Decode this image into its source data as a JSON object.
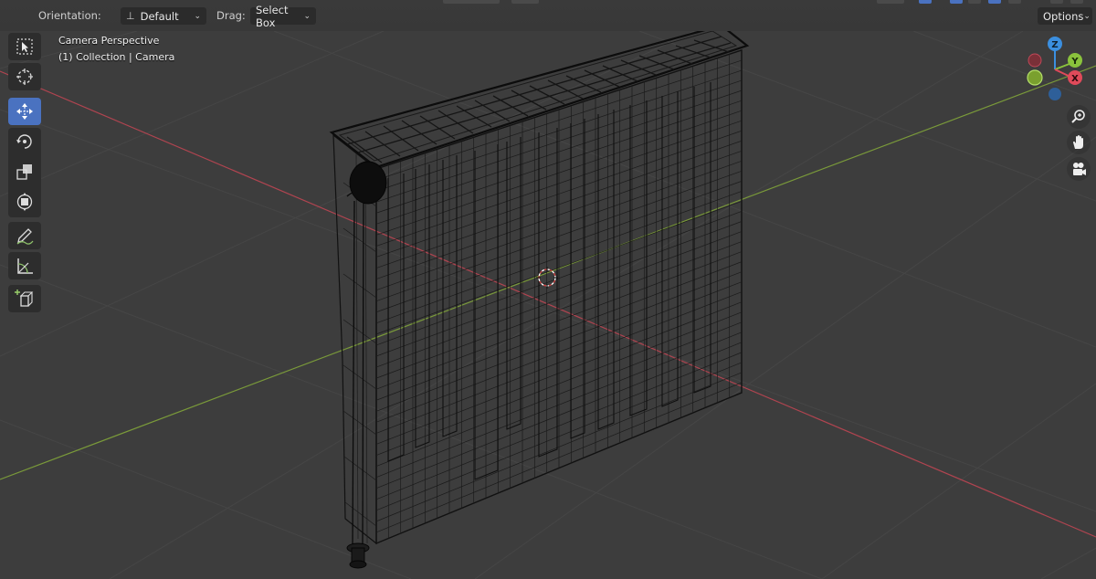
{
  "header": {
    "orientation_label": "Orientation:",
    "orientation_value": "Default",
    "drag_label": "Drag:",
    "drag_value": "Select Box",
    "options_label": "Options"
  },
  "viewport": {
    "view_name": "Camera Perspective",
    "collection_info": "(1) Collection | Camera"
  },
  "toolbar": {
    "tools": [
      "select-box",
      "cursor",
      "move",
      "rotate",
      "scale",
      "transform",
      "annotate",
      "measure",
      "add-cube"
    ],
    "active_tool": "move"
  },
  "gizmo": {
    "axes": {
      "x": "X",
      "y": "Y",
      "z": "Z"
    },
    "colors": {
      "x": "#e04a5a",
      "y": "#8ac33c",
      "z": "#3b8fe0"
    }
  },
  "nav_buttons": [
    "zoom-icon",
    "hand-pan-icon",
    "camera-icon"
  ],
  "colors": {
    "background": "#3d3d3d",
    "x_axis_line": "#b04450",
    "y_axis_line": "#7a9a3a",
    "active_tool": "#4a72c0"
  }
}
